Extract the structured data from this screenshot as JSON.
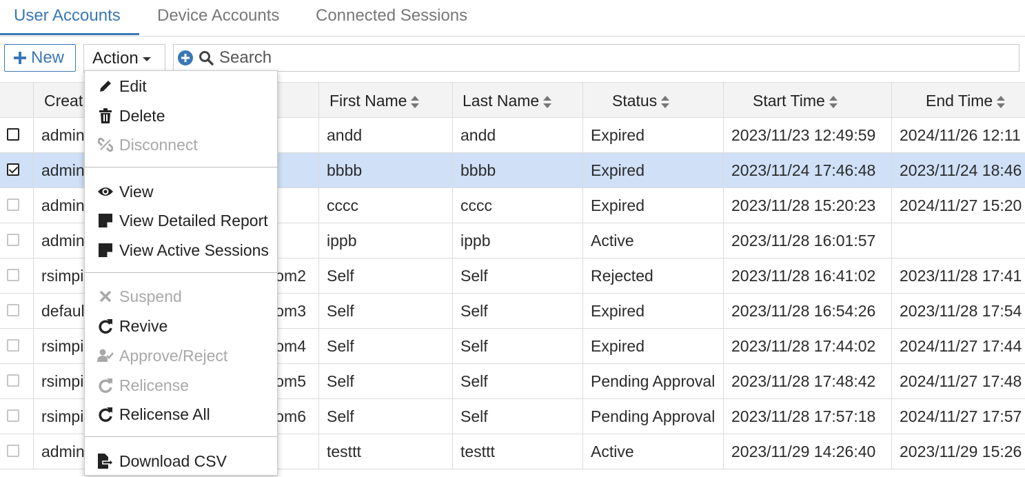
{
  "tabs": [
    {
      "label": "User Accounts",
      "active": true
    },
    {
      "label": "Device Accounts",
      "active": false
    },
    {
      "label": "Connected Sessions",
      "active": false
    }
  ],
  "toolbar": {
    "new_label": "New",
    "action_label": "Action",
    "search_placeholder": "Search"
  },
  "table": {
    "columns": [
      "Creat",
      "",
      "First Name",
      "Last Name",
      "Status",
      "Start Time",
      "End Time"
    ],
    "rows": [
      {
        "created": "admin",
        "col2": "",
        "first": "andd",
        "last": "andd",
        "status": "Expired",
        "start": "2023/11/23 12:49:59",
        "end": "2024/11/26 12:11",
        "checked": false
      },
      {
        "created": "admin",
        "col2": "",
        "first": "bbbb",
        "last": "bbbb",
        "status": "Expired",
        "start": "2023/11/24 17:46:48",
        "end": "2023/11/24 18:46",
        "checked": true
      },
      {
        "created": "admin",
        "col2": "",
        "first": "cccc",
        "last": "cccc",
        "status": "Expired",
        "start": "2023/11/28 15:20:23",
        "end": "2024/11/27 15:20",
        "checked": false
      },
      {
        "created": "admin",
        "col2": "",
        "first": "ippb",
        "last": "ippb",
        "status": "Active",
        "start": "2023/11/28 16:01:57",
        "end": "",
        "checked": false
      },
      {
        "created": "rsimpi",
        "col2": "om2",
        "first": "Self",
        "last": "Self",
        "status": "Rejected",
        "start": "2023/11/28 16:41:02",
        "end": "2023/11/28 17:41",
        "checked": false
      },
      {
        "created": "defaul",
        "col2": "om3",
        "first": "Self",
        "last": "Self",
        "status": "Expired",
        "start": "2023/11/28 16:54:26",
        "end": "2023/11/28 17:54",
        "checked": false
      },
      {
        "created": "rsimpi",
        "col2": "om4",
        "first": "Self",
        "last": "Self",
        "status": "Expired",
        "start": "2023/11/28 17:44:02",
        "end": "2024/11/27 17:44",
        "checked": false
      },
      {
        "created": "rsimpi",
        "col2": "om5",
        "first": "Self",
        "last": "Self",
        "status": "Pending Approval",
        "start": "2023/11/28 17:48:42",
        "end": "2024/11/27 17:48",
        "checked": false
      },
      {
        "created": "rsimpi",
        "col2": "om6",
        "first": "Self",
        "last": "Self",
        "status": "Pending Approval",
        "start": "2023/11/28 17:57:18",
        "end": "2024/11/27 17:57",
        "checked": false
      },
      {
        "created": "admin",
        "col2": "",
        "first": "testtt",
        "last": "testtt",
        "status": "Active",
        "start": "2023/11/29 14:26:40",
        "end": "2023/11/29 15:26",
        "checked": false
      }
    ]
  },
  "menu": {
    "items": [
      {
        "label": "Edit",
        "icon": "pencil-icon",
        "disabled": false
      },
      {
        "label": "Delete",
        "icon": "trash-icon",
        "disabled": false
      },
      {
        "label": "Disconnect",
        "icon": "unlink-icon",
        "disabled": true
      },
      {
        "label": "View",
        "icon": "eye-icon",
        "disabled": false
      },
      {
        "label": "View Detailed Report",
        "icon": "note-icon",
        "disabled": false
      },
      {
        "label": "View Active Sessions",
        "icon": "note-icon",
        "disabled": false
      },
      {
        "label": "Suspend",
        "icon": "x-icon",
        "disabled": true
      },
      {
        "label": "Revive",
        "icon": "redo-icon",
        "disabled": false
      },
      {
        "label": "Approve/Reject",
        "icon": "user-check-icon",
        "disabled": true
      },
      {
        "label": "Relicense",
        "icon": "redo-icon",
        "disabled": true
      },
      {
        "label": "Relicense All",
        "icon": "redo-icon",
        "disabled": false
      },
      {
        "label": "Download CSV",
        "icon": "file-export-icon",
        "disabled": false
      }
    ]
  },
  "colors": {
    "accent": "#3a77b6",
    "selected_row": "#cfe0f7",
    "disabled_text": "#a8a8a8"
  }
}
